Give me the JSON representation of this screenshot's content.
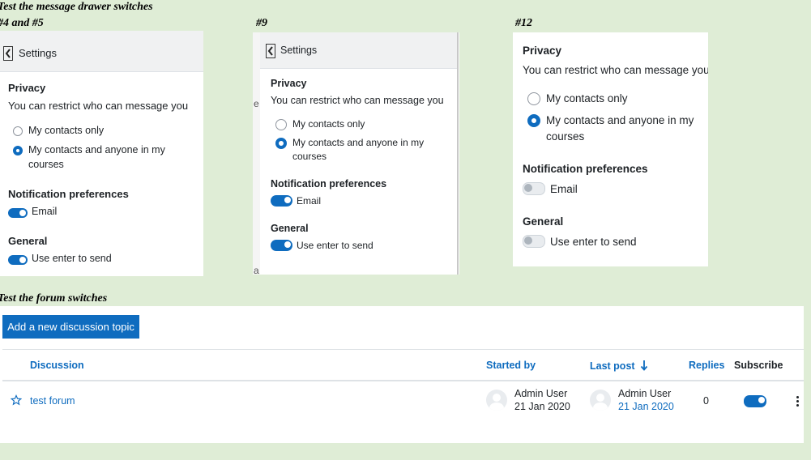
{
  "captions": {
    "drawer": "Test the message drawer switches",
    "v45": "#4 and #5",
    "v9": "#9",
    "v12": "#12",
    "forum": "Test the forum switches"
  },
  "drawer": {
    "header": "Settings",
    "privacy_heading": "Privacy",
    "privacy_desc": "You can restrict who can message you",
    "opt_contacts": "My contacts only",
    "opt_any_line1": "My contacts and anyone in my",
    "opt_any_line2": "courses",
    "notif_heading": "Notification preferences",
    "email_label": "Email",
    "general_heading": "General",
    "enter_label": "Use enter to send"
  },
  "partial_text": {
    "e": "e",
    "a": "a"
  },
  "forum": {
    "add_button": "Add a new discussion topic",
    "col_discussion": "Discussion",
    "col_started": "Started by",
    "col_lastpost": "Last post",
    "col_replies": "Replies",
    "col_subscribe": "Subscribe",
    "row": {
      "title": "test forum",
      "started_name": "Admin User",
      "started_date": "21 Jan 2020",
      "last_name": "Admin User",
      "last_date": "21 Jan 2020",
      "replies": "0"
    }
  },
  "colors": {
    "accent": "#0f6cbf",
    "background": "#dfedd6"
  }
}
